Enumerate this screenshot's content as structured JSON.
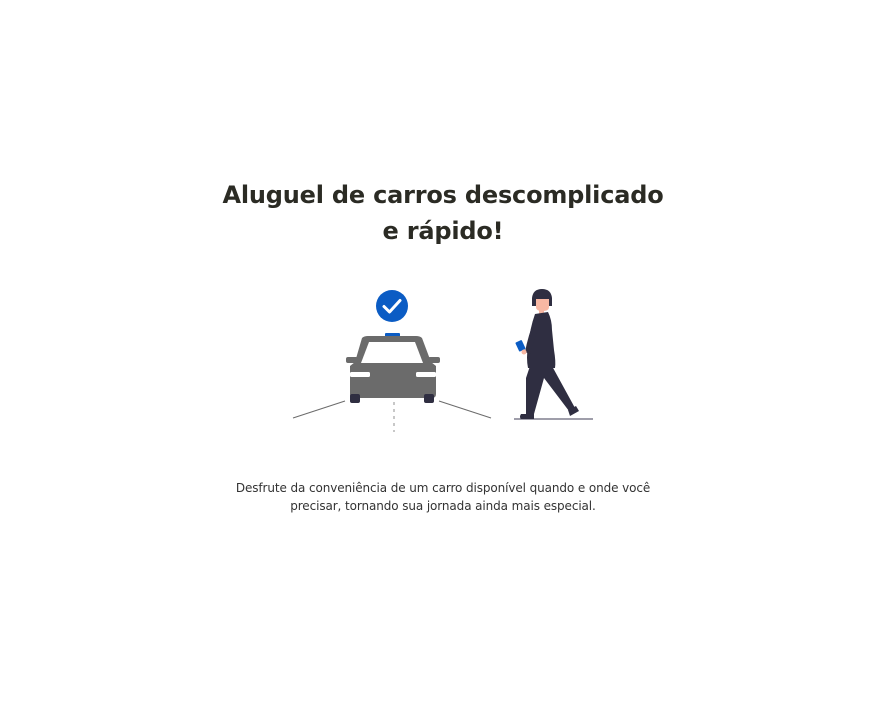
{
  "onboarding": {
    "title_line1": "Aluguel de carros descomplicado",
    "title_line2": "e rápido!",
    "description_line1": "Desfrute da conveniência de um carro disponível quando e onde você",
    "description_line2": "precisar, tornando sua jornada ainda mais especial."
  },
  "illustration": {
    "icons": [
      "car-icon",
      "check-circle-icon",
      "person-walking-icon",
      "phone-icon"
    ]
  },
  "colors": {
    "background": "#ffffff",
    "title": "#2b2b24",
    "text": "#333333",
    "accent": "#0b5cc4",
    "car": "#6b6b6b",
    "person": "#2f2e41"
  }
}
